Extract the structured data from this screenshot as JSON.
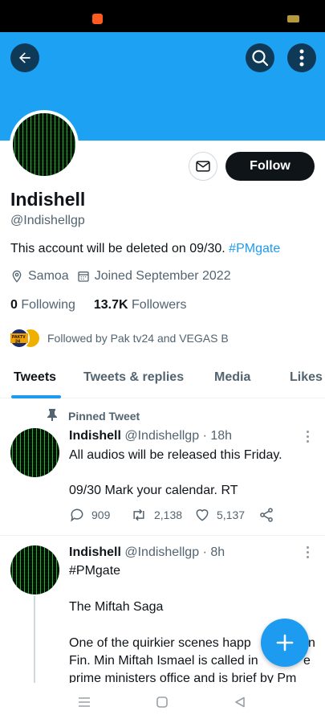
{
  "colors": {
    "banner": "#1da1f2",
    "accent": "#1d9bf0",
    "dark": "#0f1419",
    "muted": "#536471"
  },
  "header": {
    "icons": [
      "back-arrow-icon",
      "search-icon",
      "more-vertical-icon"
    ]
  },
  "profile": {
    "name": "Indishell",
    "handle": "@Indishellgp",
    "follow_label": "Follow",
    "bio_text": "This account will be deleted on 09/30. ",
    "bio_hashtag": "#PMgate",
    "location": "Samoa",
    "joined": "Joined September 2022",
    "following_count": "0",
    "following_label": "Following",
    "followers_count": "13.7K",
    "followers_label": "Followers",
    "followed_by": "Followed by Pak tv24 and VEGAS B",
    "mini_avatar_text": "PAKTV 24"
  },
  "tabs": [
    "Tweets",
    "Tweets & replies",
    "Media",
    "Likes"
  ],
  "tweets": [
    {
      "pinned_label": "Pinned Tweet",
      "name": "Indishell",
      "handle": "@Indishellgp",
      "dot": "·",
      "time": "18h",
      "line1": "All audios will be released this Friday.",
      "line2": "09/30 Mark your calendar. RT",
      "replies": "909",
      "retweets": "2,138",
      "likes": "5,137"
    },
    {
      "name": "Indishell",
      "handle": "@Indishellgp",
      "dot": "·",
      "time": "8h",
      "hashtag": "#PMgate",
      "line1": "The Miftah Saga",
      "line2": "One of the quirkier scenes happ",
      "line2_end": "n",
      "line3": "Fin. Min Miftah Ismael is called in",
      "line3_end": "e",
      "line4": "prime ministers office and is brief by Pm"
    }
  ],
  "navbar": {
    "icons": [
      "menu-icon",
      "home-square-icon",
      "back-triangle-icon"
    ]
  }
}
